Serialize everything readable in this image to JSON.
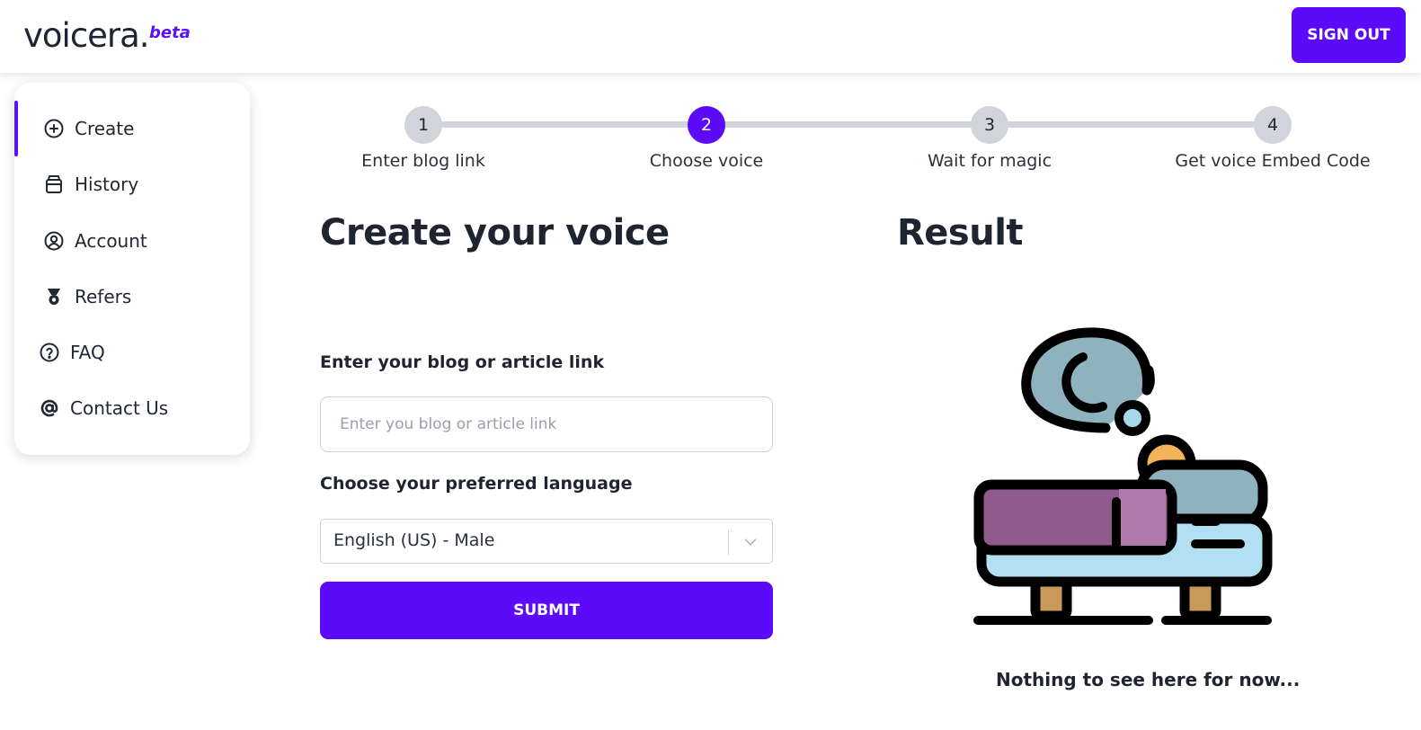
{
  "header": {
    "logo": "voicera.",
    "logo_badge": "beta",
    "signout_label": "SIGN OUT"
  },
  "sidebar": {
    "items": [
      {
        "label": "Create",
        "icon": "plus-circle-icon",
        "active": true
      },
      {
        "label": "History",
        "icon": "archive-icon"
      },
      {
        "label": "Account",
        "icon": "user-circle-icon"
      },
      {
        "label": "Refers",
        "icon": "medal-icon"
      },
      {
        "label": "FAQ",
        "icon": "question-circle-icon"
      },
      {
        "label": "Contact Us",
        "icon": "at-sign-icon"
      }
    ]
  },
  "stepper": {
    "current": 2,
    "steps": [
      {
        "number": "1",
        "label": "Enter blog link"
      },
      {
        "number": "2",
        "label": "Choose voice"
      },
      {
        "number": "3",
        "label": "Wait for magic"
      },
      {
        "number": "4",
        "label": "Get voice Embed Code"
      }
    ]
  },
  "form": {
    "title": "Create your voice",
    "link_label": "Enter your blog or article link",
    "link_placeholder": "Enter you blog or article link",
    "link_value": "",
    "language_label": "Choose your preferred language",
    "language_value": "English (US) - Male",
    "submit_label": "SUBMIT"
  },
  "result": {
    "title": "Result",
    "empty_text": "Nothing to see here for now...",
    "illustration": "sleeping-bed-illustration"
  },
  "colors": {
    "accent": "#5b0bf8",
    "step_inactive": "#d1d4da",
    "text": "#1f2530"
  }
}
